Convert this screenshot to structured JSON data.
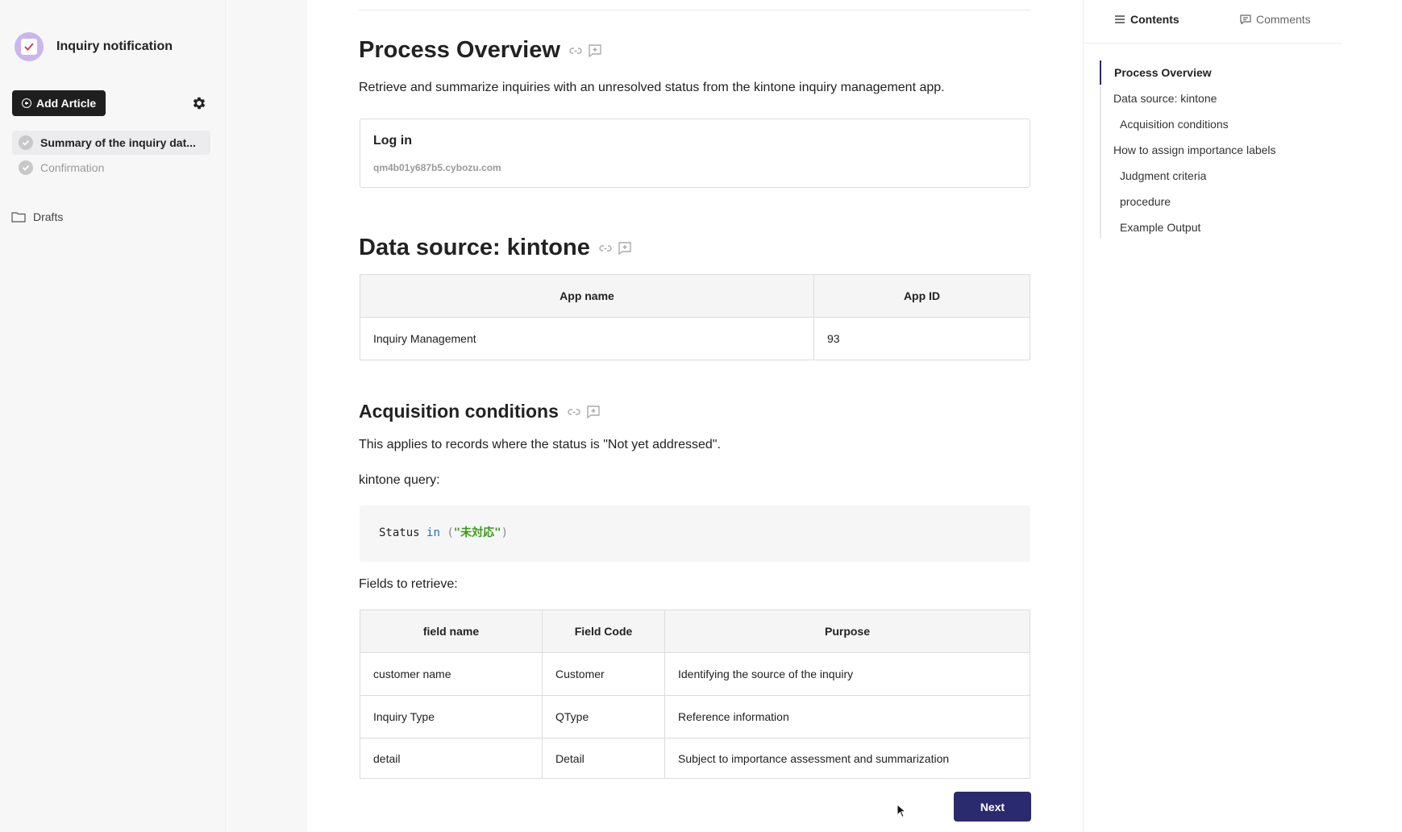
{
  "sidebar": {
    "app_title": "Inquiry notification",
    "add_article_label": "Add Article",
    "items": [
      {
        "label": "Summary of the inquiry dat...",
        "state": "active"
      },
      {
        "label": "Confirmation",
        "state": "muted"
      }
    ],
    "drafts_label": "Drafts"
  },
  "main": {
    "process_overview": {
      "heading": "Process Overview",
      "description": "Retrieve and summarize inquiries with an unresolved status from the kintone inquiry management app.",
      "login_title": "Log in",
      "login_url": "qm4b01y687b5.cybozu.com"
    },
    "data_source": {
      "heading": "Data source: kintone",
      "columns": [
        "App name",
        "App ID"
      ],
      "rows": [
        [
          "Inquiry Management",
          "93"
        ]
      ]
    },
    "acquisition": {
      "heading": "Acquisition conditions",
      "description": "This applies to records where the status is \"Not yet addressed\".",
      "query_label": "kintone query:",
      "code": {
        "field": "Status",
        "operator": "in",
        "open": "(",
        "value": "\"未対応\"",
        "close": ")"
      },
      "fields_label": "Fields to retrieve:",
      "columns": [
        "field name",
        "Field Code",
        "Purpose"
      ],
      "rows": [
        [
          "customer name",
          "Customer",
          "Identifying the source of the inquiry"
        ],
        [
          "Inquiry Type",
          "QType",
          "Reference information"
        ],
        [
          "detail",
          "Detail",
          "Subject to importance assessment and summarization"
        ]
      ]
    },
    "next_label": "Next"
  },
  "toc": {
    "tabs": {
      "contents": "Contents",
      "comments": "Comments"
    },
    "items": [
      "Process Overview",
      "Data source: kintone",
      "Acquisition conditions",
      "How to assign importance labels",
      "Judgment criteria",
      "procedure",
      "Example Output"
    ]
  },
  "colors": {
    "primary": "#2a2a6e",
    "app_icon": "#c9b6ef",
    "code_keyword": "#1f6fb2",
    "code_string": "#3b9b19"
  }
}
